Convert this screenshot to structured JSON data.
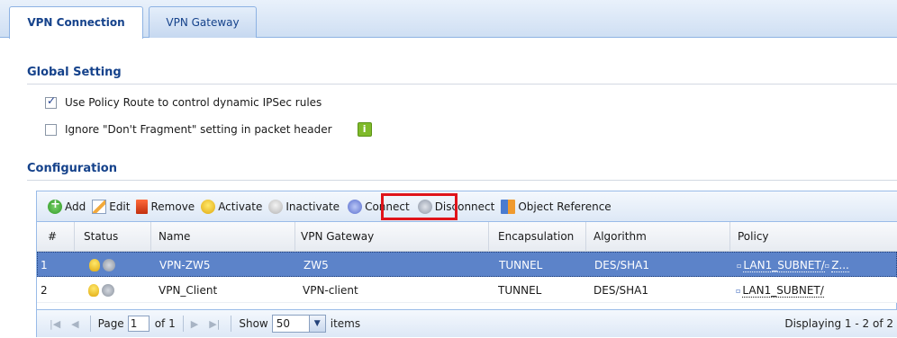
{
  "tabs": [
    {
      "label": "VPN Connection",
      "active": true
    },
    {
      "label": "VPN Gateway",
      "active": false
    }
  ],
  "global_setting": {
    "title": "Global Setting",
    "options": [
      {
        "label": "Use Policy Route to control dynamic IPSec rules",
        "checked": true
      },
      {
        "label": "Ignore \"Don't Fragment\" setting in packet header",
        "checked": false
      }
    ],
    "info_icon": "info-icon",
    "info_glyph": "i"
  },
  "configuration": {
    "title": "Configuration",
    "toolbar": {
      "add": "Add",
      "edit": "Edit",
      "remove": "Remove",
      "activate": "Activate",
      "inactivate": "Inactivate",
      "connect": "Connect",
      "disconnect": "Disconnect",
      "object_reference": "Object Reference"
    },
    "columns": [
      "#",
      "Status",
      "Name",
      "VPN Gateway",
      "Encapsulation",
      "Algorithm",
      "Policy"
    ],
    "rows": [
      {
        "index": "1",
        "name": "VPN-ZW5",
        "gateway": "ZW5",
        "encapsulation": "TUNNEL",
        "algorithm": "DES/SHA1",
        "policy": "LAN1_SUBNET/",
        "policy_extra": "Z...",
        "selected": true
      },
      {
        "index": "2",
        "name": "VPN_Client",
        "gateway": "VPN-client",
        "encapsulation": "TUNNEL",
        "algorithm": "DES/SHA1",
        "policy": "LAN1_SUBNET/",
        "policy_extra": "",
        "selected": false
      }
    ],
    "pager": {
      "page_label": "Page",
      "page_value": "1",
      "of_label": "of 1",
      "show_label": "Show",
      "page_size": "50",
      "items_label": "items",
      "display_text": "Displaying 1 - 2 of 2"
    }
  },
  "colors": {
    "accent": "#15428b",
    "selected_row": "#5c83c9",
    "highlight_box": "#e0141a"
  }
}
